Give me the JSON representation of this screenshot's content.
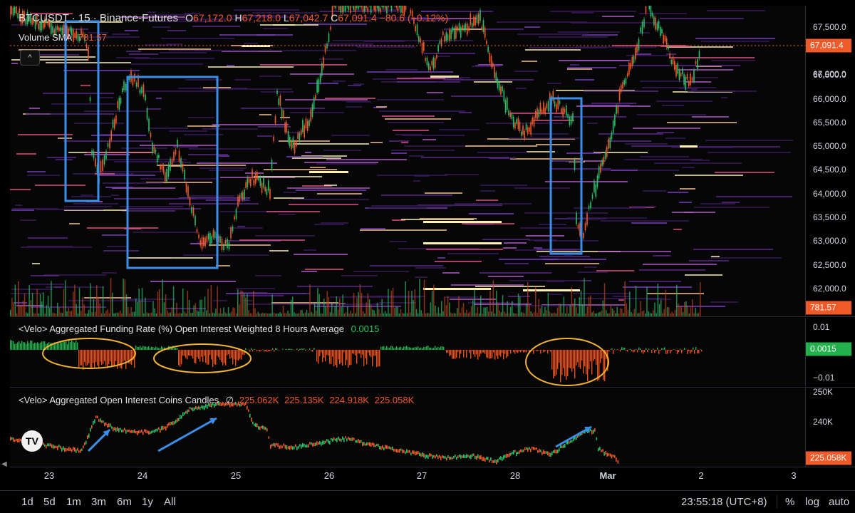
{
  "header": {
    "symbol": "BTCUSDT",
    "interval": "· 15 ·",
    "exchange": "Binance-Futures",
    "o_label": "O",
    "o_value": "67,172.0",
    "h_label": "H",
    "h_value": "67,218.0",
    "l_label": "L",
    "l_value": "67,042.7",
    "c_label": "C",
    "c_value": "67,091.4",
    "change": "−80.6 (−0.12%)"
  },
  "volume": {
    "label": "Volume SMA",
    "value": "781.57"
  },
  "main_axis": {
    "ticks": [
      "67,500.0",
      "67,000.0",
      "66,500.0",
      "66,000.0",
      "65,500.0",
      "65,000.0",
      "64,500.0",
      "64,000.0",
      "63,500.0",
      "63,000.0",
      "62,500.0",
      "62,000.0"
    ],
    "last_price_tag": "67,091.4",
    "volume_tag": "781.57",
    "last_price_color": "#f05a28"
  },
  "funding": {
    "label": "<Velo> Aggregated Funding Rate (%) Open Interest Weighted 8 Hours Average",
    "value": "0.0015",
    "ticks": [
      "0.01",
      "−0.01"
    ],
    "tag": "0.0015",
    "tag_color": "#22b14c"
  },
  "oi": {
    "label": "<Velo> Aggregated Open Interest Coins Candles",
    "symbol": "∅",
    "o": "225.062K",
    "h": "225.135K",
    "l": "224.918K",
    "c": "225.058K",
    "ticks": [
      "250K",
      "240K"
    ],
    "tag": "225.058K"
  },
  "xaxis": {
    "labels": [
      "23",
      "24",
      "25",
      "26",
      "27",
      "28",
      "Mar",
      "2",
      "3"
    ]
  },
  "bottom_bar": {
    "ranges": [
      "1d",
      "5d",
      "1m",
      "3m",
      "6m",
      "1y",
      "All"
    ],
    "time": "23:55:18 (UTC+8)",
    "percent": "%",
    "log": "log",
    "auto": "auto"
  },
  "logo": {
    "text": "TV",
    "icon": "tradingview-logo"
  },
  "collapse": {
    "glyph": "^"
  },
  "colors": {
    "up": "#26a69a",
    "down": "#f05a28",
    "annotation_box": "#3b8eea",
    "ellipse": "#f2b233",
    "arrow": "#3b8eea",
    "funding_pos": "#22b14c",
    "funding_neg": "#e8501e"
  }
}
